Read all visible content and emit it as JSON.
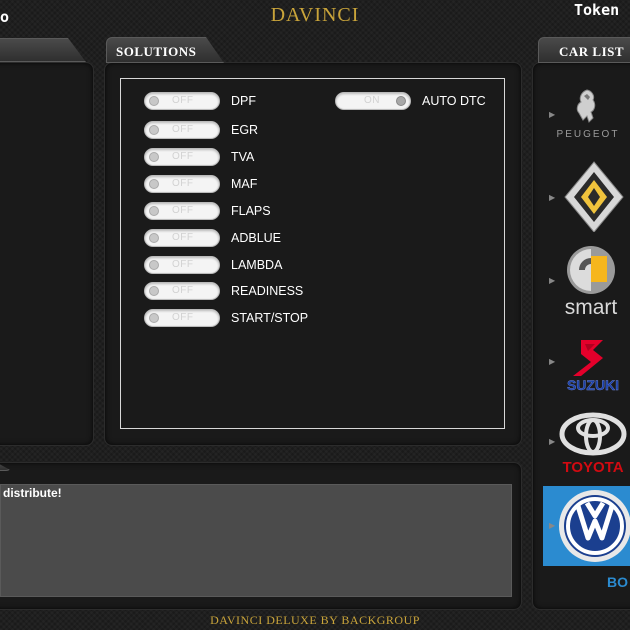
{
  "header": {
    "left_cut_text": "o",
    "app_title": "DAVINCI",
    "token_label": "Token"
  },
  "solutions": {
    "tab_label": "SOLUTIONS",
    "toggles": [
      {
        "label": "DPF",
        "state": "OFF"
      },
      {
        "label": "EGR",
        "state": "OFF"
      },
      {
        "label": "TVA",
        "state": "OFF"
      },
      {
        "label": "MAF",
        "state": "OFF"
      },
      {
        "label": "FLAPS",
        "state": "OFF"
      },
      {
        "label": "ADBLUE",
        "state": "OFF"
      },
      {
        "label": "LAMBDA",
        "state": "OFF"
      },
      {
        "label": "READINESS",
        "state": "OFF"
      },
      {
        "label": "START/STOP",
        "state": "OFF"
      }
    ],
    "auto_dtc": {
      "label": "AUTO DTC",
      "state": "ON"
    }
  },
  "log": {
    "text": " distribute!"
  },
  "car_list": {
    "tab_label": "CAR LIST",
    "items": [
      {
        "name": "PEUGEOT",
        "icon": "peugeot-lion-icon"
      },
      {
        "name": "",
        "icon": "renault-diamond-icon"
      },
      {
        "name": "smart",
        "icon": "smart-logo-icon"
      },
      {
        "name": "SUZUKI",
        "icon": "suzuki-s-icon"
      },
      {
        "name": "TOYOTA",
        "icon": "toyota-ellipses-icon"
      },
      {
        "name": "BO",
        "icon": "vw-logo-icon",
        "selected": true
      }
    ]
  },
  "footer": {
    "text": "DAVINCI DELUXE BY BACKGROUP"
  },
  "colors": {
    "gold": "#c9a43a",
    "selected_bg": "#2b8bd0",
    "suzuki_red": "#e4002b",
    "suzuki_blue": "#1a3fa6",
    "toyota_red": "#d20a11"
  }
}
